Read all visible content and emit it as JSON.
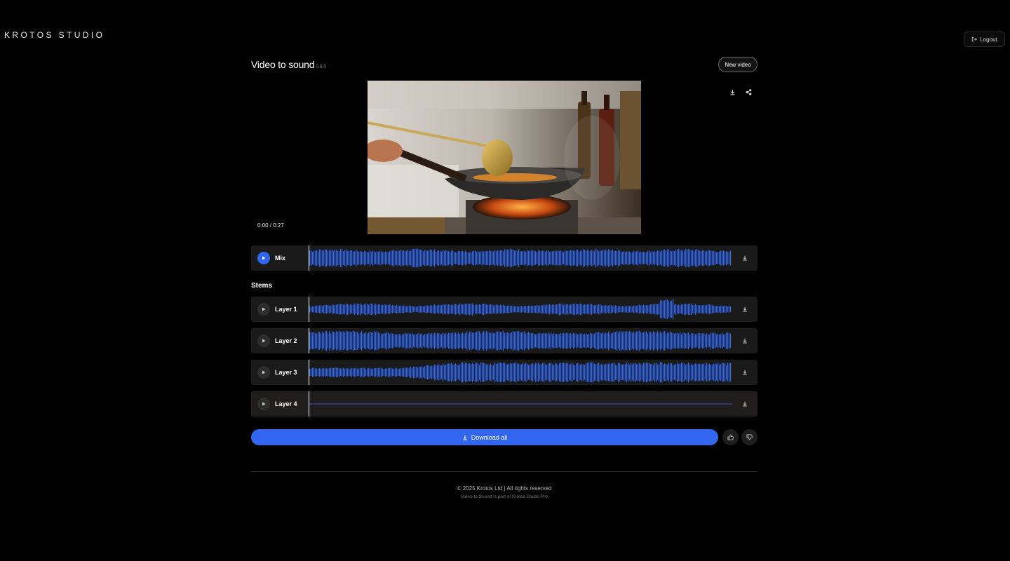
{
  "brand": {
    "name": "KROTOS STUDIO"
  },
  "header": {
    "logout_label": "Logout"
  },
  "page": {
    "title": "Video to sound",
    "version": "0.8.0",
    "new_video_label": "New video"
  },
  "player": {
    "time": "0:00 / 0:27"
  },
  "mix": {
    "label": "Mix"
  },
  "stems": {
    "title": "Stems",
    "layers": [
      {
        "label": "Layer 1"
      },
      {
        "label": "Layer 2"
      },
      {
        "label": "Layer 3"
      },
      {
        "label": "Layer 4"
      }
    ]
  },
  "actions": {
    "download_all_label": "Download all"
  },
  "footer": {
    "copyright": "© 2025 Krotos Ltd | All rights reserved",
    "sub": "Video to Sound is part of Krotos Studio Pro"
  },
  "colors": {
    "accent": "#3366ee",
    "track_bg": "#1a1a1a",
    "background": "#000000"
  },
  "icons": {
    "logout": "logout-icon",
    "download": "download-icon",
    "share": "share-icon",
    "play": "play-icon",
    "thumbs_up": "thumbs-up-icon",
    "thumbs_down": "thumbs-down-icon"
  }
}
